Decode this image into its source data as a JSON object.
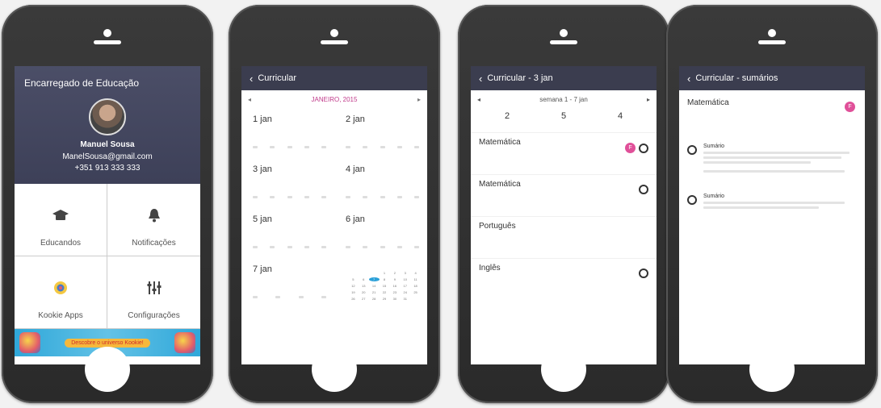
{
  "screen1": {
    "title": "Encarregado de Educação",
    "name": "Manuel Sousa",
    "email": "ManelSousa@gmail.com",
    "phone": "+351 913 333 333",
    "tiles": [
      {
        "label": "Educandos",
        "icon": "graduation-cap-icon"
      },
      {
        "label": "Notificações",
        "icon": "bell-icon"
      },
      {
        "label": "Kookie Apps",
        "icon": "app-icon"
      },
      {
        "label": "Configurações",
        "icon": "sliders-icon"
      }
    ],
    "banner": "Descobre o universo Kookie!"
  },
  "screen2": {
    "title": "Curricular",
    "month": "JANEIRO, 2015",
    "days": [
      "1 jan",
      "2 jan",
      "3 jan",
      "4 jan",
      "5 jan",
      "6 jan",
      "7 jan"
    ],
    "mini_cal": [
      "",
      "",
      "",
      "1",
      "2",
      "3",
      "4",
      "5",
      "6",
      "7",
      "8",
      "9",
      "10",
      "11",
      "12",
      "13",
      "14",
      "15",
      "16",
      "17",
      "18",
      "19",
      "20",
      "21",
      "22",
      "23",
      "24",
      "25",
      "26",
      "27",
      "28",
      "29",
      "30",
      "31",
      ""
    ]
  },
  "screen3": {
    "title": "Curricular - 3 jan",
    "week": "semana 1 - 7 jan",
    "stats": [
      {
        "n": "2"
      },
      {
        "n": "5"
      },
      {
        "n": "4"
      }
    ],
    "subjects": [
      {
        "name": "Matemática",
        "badge": "F"
      },
      {
        "name": "Matemática"
      },
      {
        "name": "Português"
      },
      {
        "name": "Inglês"
      }
    ]
  },
  "screen4": {
    "title": "Curricular - sumários",
    "subject": "Matemática",
    "badge": "F",
    "summaries": [
      "Sumário",
      "Sumário"
    ]
  },
  "colors": {
    "header": "#3b3d4f",
    "accent": "#e05099",
    "banner": "#2fa7d9"
  }
}
